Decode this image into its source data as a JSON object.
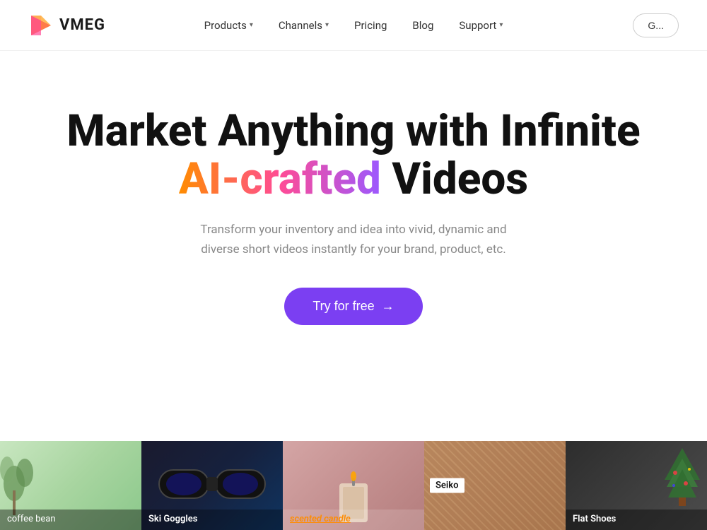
{
  "header": {
    "logo_text": "VMEG",
    "nav": {
      "items": [
        {
          "label": "Products",
          "has_dropdown": true
        },
        {
          "label": "Channels",
          "has_dropdown": true
        },
        {
          "label": "Pricing",
          "has_dropdown": false
        },
        {
          "label": "Blog",
          "has_dropdown": false
        },
        {
          "label": "Support",
          "has_dropdown": true
        }
      ]
    },
    "cta_partial": "G"
  },
  "hero": {
    "title_line1": "Market Anything with Infinite",
    "title_gradient": "AI-crafted",
    "title_line2": "Videos",
    "subtitle": "Transform your inventory and idea into vivid, dynamic and diverse short videos instantly for your brand, product, etc.",
    "cta_button": "Try for free",
    "cta_arrow": "→"
  },
  "video_cards": [
    {
      "id": "coffee",
      "label": "coffee bean",
      "label_style": "plain"
    },
    {
      "id": "ski",
      "label": "Ski Goggles",
      "label_style": "plain"
    },
    {
      "id": "candle",
      "label": "scented candle",
      "label_style": "italic-orange"
    },
    {
      "id": "seiko",
      "label": "Seiko",
      "label_style": "white-badge"
    },
    {
      "id": "shoes",
      "label": "Flat Shoes",
      "label_style": "plain"
    }
  ],
  "colors": {
    "brand_purple": "#7B3FF2",
    "gradient_orange": "#FF8C00",
    "gradient_pink": "#FF4B96",
    "gradient_violet": "#9B59FF"
  }
}
